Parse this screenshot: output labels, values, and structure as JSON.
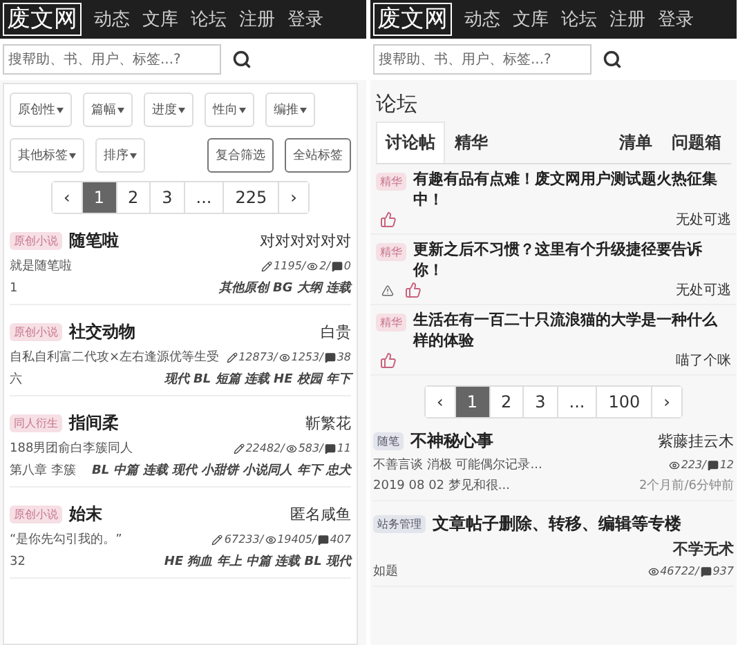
{
  "screens": [
    {
      "logo": "废文网",
      "nav": [
        "动态",
        "文库",
        "论坛",
        "注册",
        "登录"
      ],
      "search": {
        "placeholder": "搜帮助、书、用户、标签...?"
      },
      "filters": [
        {
          "label": "原创性",
          "kind": "dropdown"
        },
        {
          "label": "篇幅",
          "kind": "dropdown"
        },
        {
          "label": "进度",
          "kind": "dropdown"
        },
        {
          "label": "性向",
          "kind": "dropdown"
        },
        {
          "label": "编推",
          "kind": "dropdown"
        },
        {
          "label": "其他标签",
          "kind": "dropdown"
        },
        {
          "label": "排序",
          "kind": "dropdown"
        },
        {
          "label": "复合筛选",
          "kind": "button"
        },
        {
          "label": "全站标签",
          "kind": "button"
        }
      ],
      "pagination": [
        {
          "label": "‹",
          "selected": false
        },
        {
          "label": "1",
          "selected": true
        },
        {
          "label": "2",
          "selected": false
        },
        {
          "label": "3",
          "selected": false
        },
        {
          "label": "...",
          "selected": false
        },
        {
          "label": "225",
          "selected": false
        },
        {
          "label": "›",
          "selected": false
        }
      ],
      "books": [
        {
          "badge": "原创小说",
          "color": "#f6dfe5",
          "title": "随笔啦",
          "author": "对对对对对对",
          "summary": "就是随笔啦",
          "stats": [
            {
              "kind": "words",
              "value": "1195/"
            },
            {
              "kind": "views",
              "value": "2/"
            },
            {
              "kind": "replies",
              "value": "0"
            }
          ],
          "chapter": "1",
          "tags": "其他原创 BG 大纲 连载"
        },
        {
          "badge": "原创小说",
          "color": "#f6dfe5",
          "title": "社交动物",
          "author": "白贵",
          "summary": "自私自利富二代攻×左右逢源优等生受",
          "stats": [
            {
              "kind": "words",
              "value": "12873/"
            },
            {
              "kind": "views",
              "value": "1253/"
            },
            {
              "kind": "replies",
              "value": "38"
            }
          ],
          "chapter": "六",
          "tags": "现代 BL 短篇 连载 HE 校园 年下"
        },
        {
          "badge": "同人衍生",
          "color": "#f6dfe5",
          "title": "指间柔",
          "author": "靳繁花",
          "summary": "188男团俞白李簇同人",
          "stats": [
            {
              "kind": "words",
              "value": "22482/"
            },
            {
              "kind": "views",
              "value": "583/"
            },
            {
              "kind": "replies",
              "value": "11"
            }
          ],
          "chapter": "第八章 李簇",
          "tags": "BL 中篇 连载 现代 小甜饼 小说同人 年下 忠犬"
        },
        {
          "badge": "原创小说",
          "color": "#f6dfe5",
          "title": "始末",
          "author": "匿名咸鱼",
          "summary": "“是你先勾引我的。”",
          "stats": [
            {
              "kind": "words",
              "value": "67233/"
            },
            {
              "kind": "views",
              "value": "19405/"
            },
            {
              "kind": "replies",
              "value": "407"
            }
          ],
          "chapter": "32",
          "tags": "HE 狗血 年上 中篇 连载 BL 现代"
        }
      ]
    },
    {
      "logo": "废文网",
      "nav": [
        "动态",
        "文库",
        "论坛",
        "注册",
        "登录"
      ],
      "search": {
        "placeholder": "搜帮助、书、用户、标签...?"
      },
      "heading": "论坛",
      "tabs": [
        {
          "label": "讨论帖",
          "selected": true
        },
        {
          "label": "精华",
          "selected": false
        },
        {
          "label": "清单",
          "selected": false
        },
        {
          "label": "问题箱",
          "selected": false
        }
      ],
      "threads": [
        {
          "badge": "精华",
          "color": "#f6dfe5",
          "title": "有趣有品有点难！废文网用户测试题火热征集中！",
          "like": true,
          "warning": false,
          "author": "无处可逃"
        },
        {
          "badge": "精华",
          "color": "#f6dfe5",
          "title": "更新之后不习惯？这里有个升级捷径要告诉你！",
          "like": true,
          "warning": true,
          "author": "无处可逃"
        },
        {
          "badge": "精华",
          "color": "#f6dfe5",
          "title": "生活在有一百二十只流浪猫的大学是一种什么样的体验",
          "like": true,
          "warning": false,
          "author": "喵了个咪"
        }
      ],
      "pagination": [
        {
          "label": "‹",
          "selected": false
        },
        {
          "label": "1",
          "selected": true
        },
        {
          "label": "2",
          "selected": false
        },
        {
          "label": "3",
          "selected": false
        },
        {
          "label": "...",
          "selected": false
        },
        {
          "label": "100",
          "selected": false
        },
        {
          "label": "›",
          "selected": false
        }
      ],
      "posts": [
        {
          "badge": "随笔",
          "color": "#e3e5ec",
          "title": "不神秘心事",
          "author": "紫藤挂云木",
          "summary": "不善言谈 消极 可能偶尔记录...",
          "stats": [
            {
              "kind": "views",
              "value": "223/"
            },
            {
              "kind": "replies",
              "value": "12"
            }
          ],
          "latest": "2019 08 02 梦见和很...",
          "time": "2个月前/6分钟前"
        },
        {
          "badge": "站务管理",
          "color": "#e3e5ec",
          "title": "文章帖子删除、转移、编辑等专楼",
          "author": "不学无术",
          "summary": "如题",
          "stats": [
            {
              "kind": "views",
              "value": "46722/"
            },
            {
              "kind": "replies",
              "value": "937"
            }
          ]
        }
      ]
    }
  ]
}
